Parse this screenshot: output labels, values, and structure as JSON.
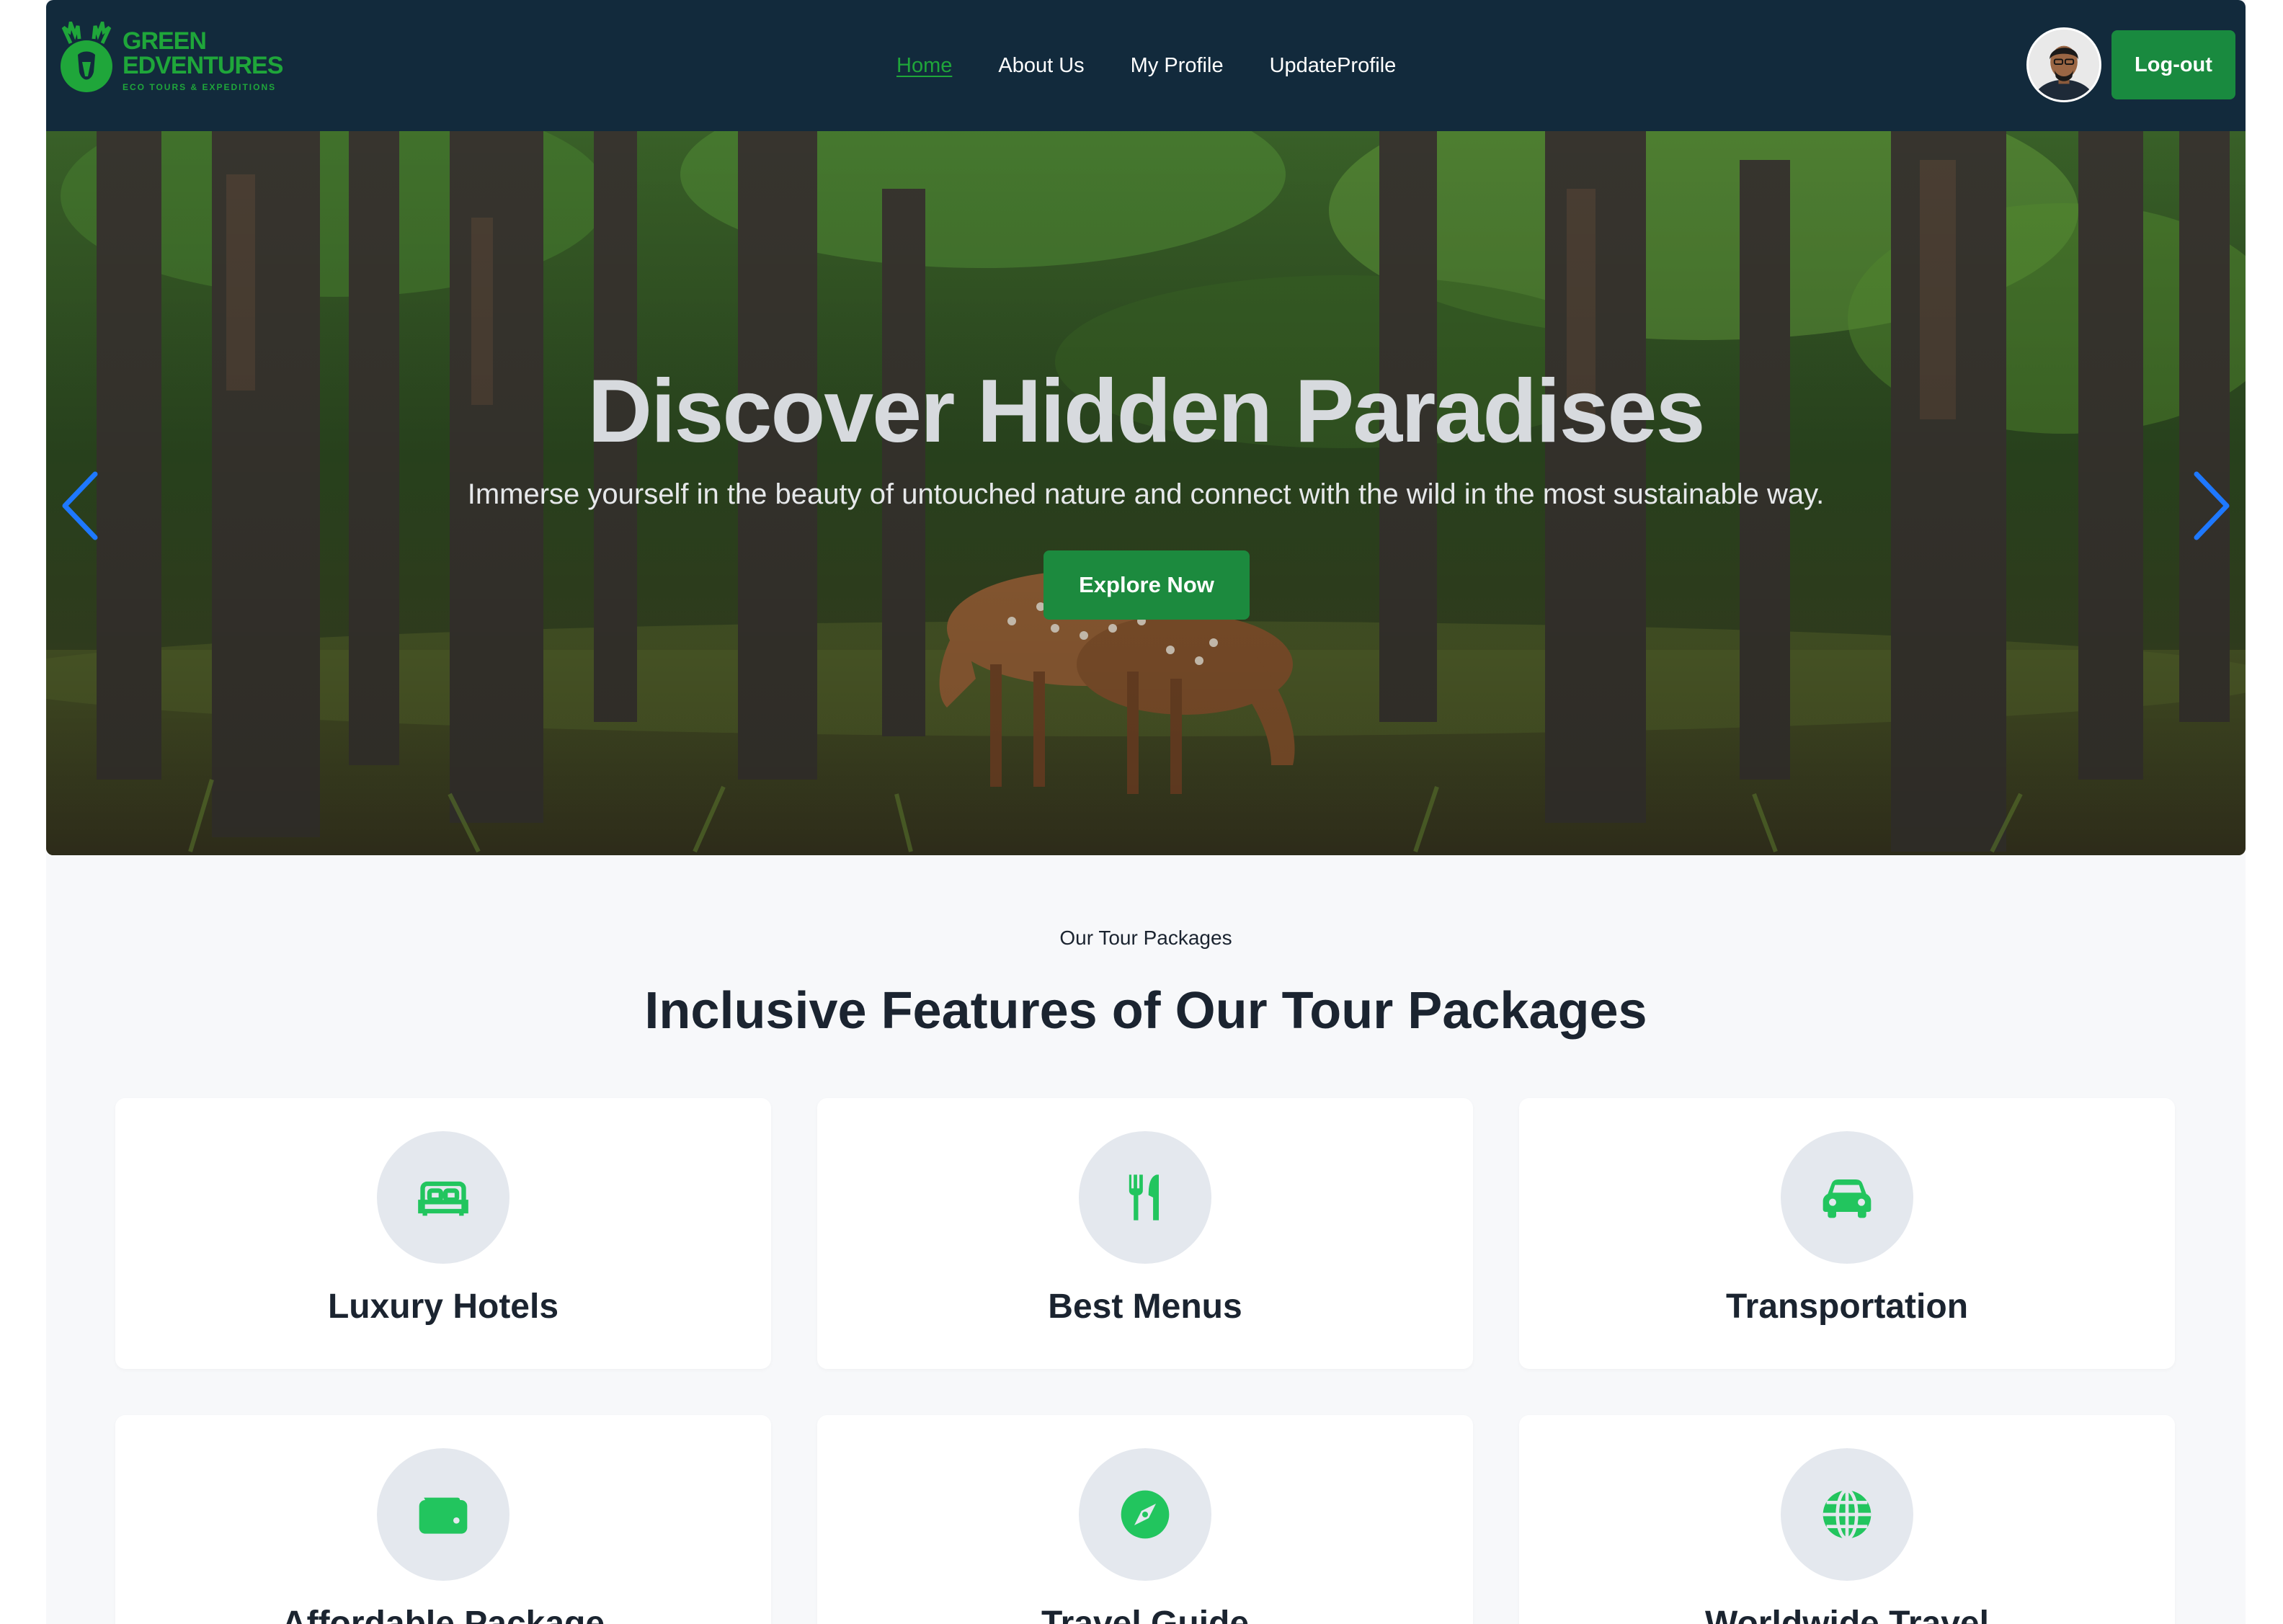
{
  "brand": {
    "line1": "GREEN",
    "line2": "EDVENTURES",
    "tagline": "ECO TOURS & EXPEDITIONS",
    "color": "#1fa63a"
  },
  "nav": {
    "links": [
      {
        "label": "Home",
        "active": true
      },
      {
        "label": "About Us",
        "active": false
      },
      {
        "label": "My Profile",
        "active": false
      },
      {
        "label": "UpdateProfile",
        "active": false
      }
    ],
    "logout_label": "Log-out",
    "avatar_icon": "user-avatar"
  },
  "hero": {
    "title": "Discover Hidden Paradises",
    "subtitle": "Immerse yourself in the beauty of untouched nature and connect with the wild in the most sustainable way.",
    "cta_label": "Explore Now",
    "prev_icon": "chevron-left-icon",
    "next_icon": "chevron-right-icon"
  },
  "features": {
    "eyebrow": "Our Tour Packages",
    "title": "Inclusive Features of Our Tour Packages",
    "accent": "#22c55e",
    "items": [
      {
        "label": "Luxury Hotels",
        "icon": "bed-icon"
      },
      {
        "label": "Best Menus",
        "icon": "utensils-icon"
      },
      {
        "label": "Transportation",
        "icon": "car-icon"
      },
      {
        "label": "Affordable Package",
        "icon": "wallet-icon"
      },
      {
        "label": "Travel Guide",
        "icon": "compass-icon"
      },
      {
        "label": "Worldwide Travel",
        "icon": "globe-icon"
      }
    ]
  },
  "colors": {
    "navbar": "#122a3c",
    "primary_button": "#198a3f",
    "page_bg": "#f7f8fa",
    "heading": "#1b2430"
  }
}
